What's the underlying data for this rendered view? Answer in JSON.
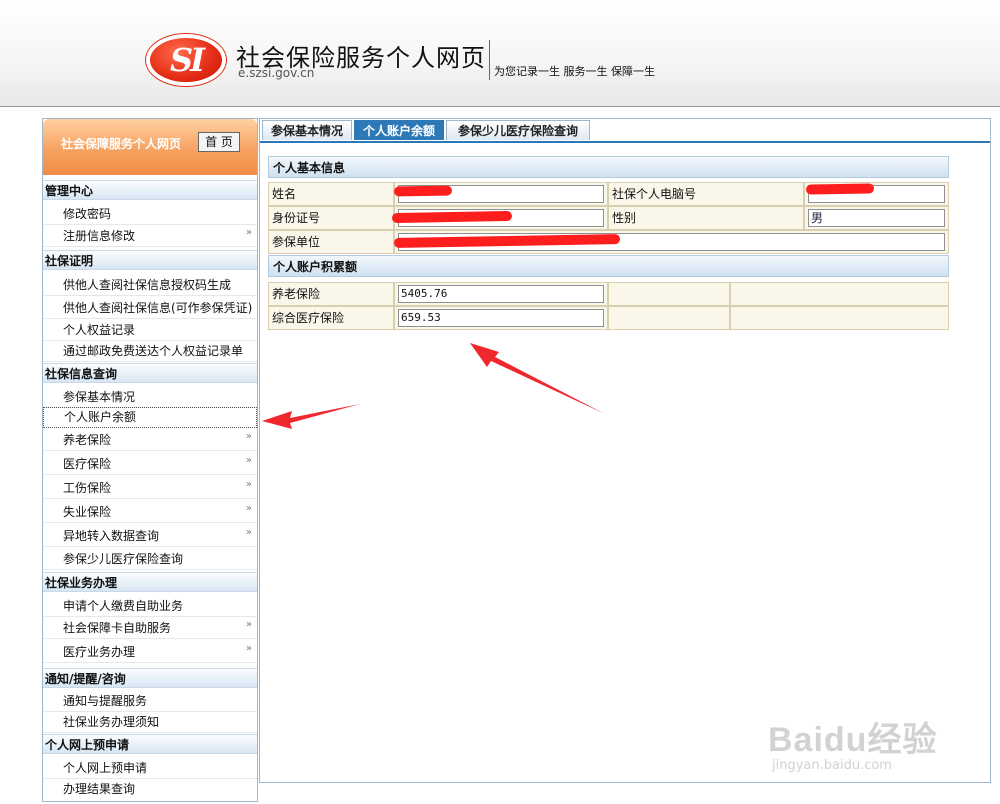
{
  "header": {
    "logo_text": "SI",
    "title": "社会保险服务个人网页",
    "url": "e.szsi.gov.cn",
    "slogan": "为您记录一生 服务一生 保障一生"
  },
  "sidebar": {
    "banner_title": "社会保障服务个人网页",
    "home_button": "首 页",
    "sections": [
      {
        "title": "管理中心",
        "items": [
          {
            "label": "修改密码",
            "has_arrow": false
          },
          {
            "label": "注册信息修改",
            "has_arrow": true
          }
        ]
      },
      {
        "title": "社保证明",
        "items": [
          {
            "label": "供他人查阅社保信息授权码生成",
            "has_arrow": false
          },
          {
            "label": "供他人查阅社保信息(可作参保凭证)",
            "has_arrow": false
          },
          {
            "label": "个人权益记录",
            "has_arrow": false
          },
          {
            "label": "通过邮政免费送达个人权益记录单",
            "has_arrow": false
          }
        ]
      },
      {
        "title": "社保信息查询",
        "items": [
          {
            "label": "参保基本情况",
            "has_arrow": false
          },
          {
            "label": "个人账户余额",
            "has_arrow": false,
            "active": true
          },
          {
            "label": "养老保险",
            "has_arrow": true
          },
          {
            "label": "医疗保险",
            "has_arrow": true
          },
          {
            "label": "工伤保险",
            "has_arrow": true
          },
          {
            "label": "失业保险",
            "has_arrow": true
          },
          {
            "label": "异地转入数据查询",
            "has_arrow": true
          },
          {
            "label": "参保少儿医疗保险查询",
            "has_arrow": false
          }
        ]
      },
      {
        "title": "社保业务办理",
        "items": [
          {
            "label": "申请个人缴费自助业务",
            "has_arrow": false
          },
          {
            "label": "社会保障卡自助服务",
            "has_arrow": true
          },
          {
            "label": "医疗业务办理",
            "has_arrow": true
          }
        ]
      },
      {
        "title": "通知/提醒/咨询",
        "items": [
          {
            "label": "通知与提醒服务",
            "has_arrow": false
          },
          {
            "label": "社保业务办理须知",
            "has_arrow": false
          }
        ]
      },
      {
        "title": "个人网上预申请",
        "items": [
          {
            "label": "个人网上预申请",
            "has_arrow": false
          },
          {
            "label": "办理结果查询",
            "has_arrow": false
          }
        ]
      }
    ],
    "arrow_glyph": "»"
  },
  "main": {
    "tabs": [
      {
        "label": "参保基本情况",
        "active": false
      },
      {
        "label": "个人账户余额",
        "active": true
      },
      {
        "label": "参保少儿医疗保险查询",
        "active": false
      }
    ],
    "basic_info": {
      "heading": "个人基本信息",
      "name_label": "姓名",
      "name_value": "",
      "computer_no_label": "社保个人电脑号",
      "computer_no_value": "",
      "id_label": "身份证号",
      "id_value": "",
      "gender_label": "性别",
      "gender_value": "男",
      "employer_label": "参保单位",
      "employer_value": ""
    },
    "balance": {
      "heading": "个人账户积累额",
      "pension_label": "养老保险",
      "pension_value": "5405.76",
      "medical_label": "综合医疗保险",
      "medical_value": "659.53"
    }
  },
  "watermark": {
    "main": "Baidu经验",
    "sub": "jingyan.baidu.com"
  },
  "colors": {
    "tab_active": "#2d79b8",
    "redaction": "#ff1e1e",
    "annotation_arrow": "#f0282d",
    "logo_red": "#e32a14"
  }
}
